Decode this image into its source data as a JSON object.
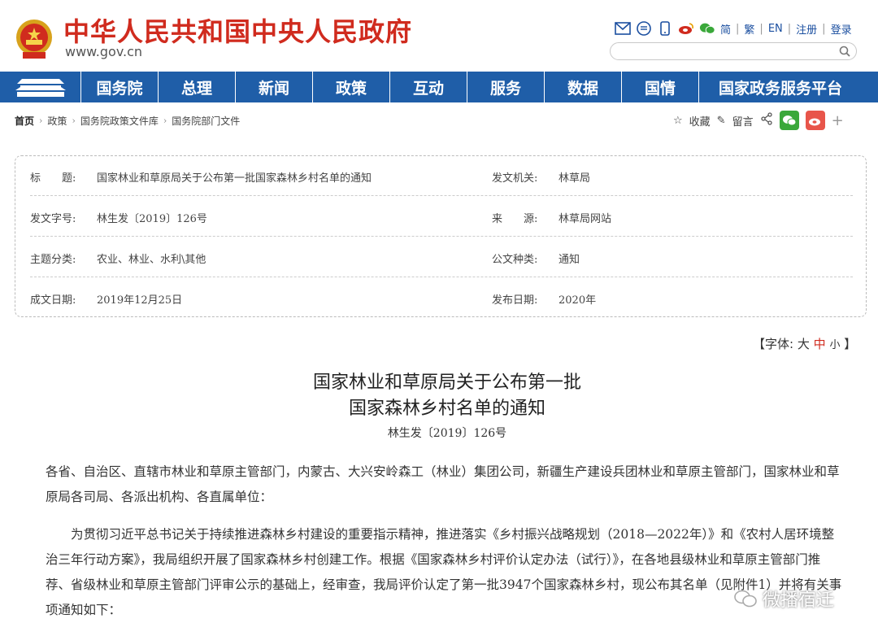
{
  "header": {
    "site_title": "中华人民共和国中央人民政府",
    "site_url": "www.gov.cn",
    "top_links": [
      "简",
      "繁",
      "EN",
      "注册",
      "登录"
    ],
    "search_placeholder": ""
  },
  "nav": {
    "items": [
      "国务院",
      "总理",
      "新闻",
      "政策",
      "互动",
      "服务",
      "数据",
      "国情"
    ],
    "platform": "国家政务服务平台"
  },
  "breadcrumb": [
    "首页",
    "政策",
    "国务院政策文件库",
    "国务院部门文件"
  ],
  "tools": {
    "favorite": "收藏",
    "comment": "留言",
    "plus": "+"
  },
  "info": {
    "rows": [
      {
        "l_label": "标　　题:",
        "l_value": "国家林业和草原局关于公布第一批国家森林乡村名单的通知",
        "r_label": "发文机关:",
        "r_value": "林草局"
      },
      {
        "l_label": "发文字号:",
        "l_value": "林生发〔2019〕126号",
        "r_label": "来　　源:",
        "r_value": "林草局网站"
      },
      {
        "l_label": "主题分类:",
        "l_value": "农业、林业、水利\\其他",
        "r_label": "公文种类:",
        "r_value": "通知"
      },
      {
        "l_label": "成文日期:",
        "l_value": "2019年12月25日",
        "r_label": "发布日期:",
        "r_value": "2020年"
      }
    ]
  },
  "fontsize": {
    "open": "【字体:",
    "large": "大",
    "medium": "中",
    "small": "小",
    "close": "】"
  },
  "document": {
    "title_line1": "国家林业和草原局关于公布第一批",
    "title_line2": "国家森林乡村名单的通知",
    "number": "林生发〔2019〕126号",
    "addressees": "各省、自治区、直辖市林业和草原主管部门，内蒙古、大兴安岭森工（林业）集团公司，新疆生产建设兵团林业和草原主管部门，国家林业和草原局各司局、各派出机构、各直属单位：",
    "body": "　　为贯彻习近平总书记关于持续推进森林乡村建设的重要指示精神，推进落实《乡村振兴战略规划（2018—2022年）》和《农村人居环境整治三年行动方案》，我局组织开展了国家森林乡村创建工作。根据《国家森林乡村评价认定办法（试行）》，在各地县级林业和草原主管部门推荐、省级林业和草原主管部门评审公示的基础上，经审查，我局评价认定了第一批3947个国家森林乡村，现公布其名单（见附件1）并将有关事项通知如下："
  },
  "watermark": "微播宿迁",
  "colors": {
    "brand_red": "#d02b1e",
    "nav_blue": "#1f5ea8",
    "link_blue": "#1b4fa0"
  }
}
